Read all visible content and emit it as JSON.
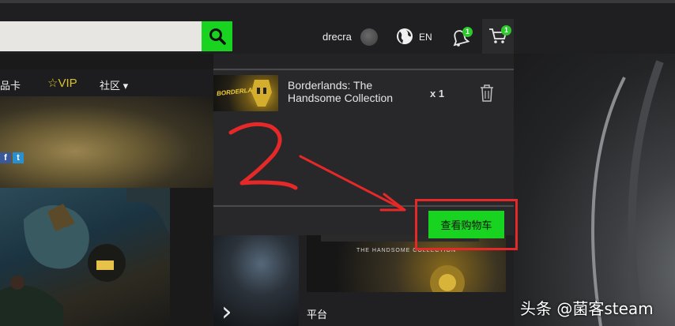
{
  "header": {
    "search": {
      "placeholder": "",
      "value": ""
    },
    "username": "drecra",
    "language": "EN",
    "notifications_count": "1",
    "cart_count": "1"
  },
  "nav": {
    "cards_label": "品卡",
    "vip_label": "VIP",
    "community_label": "社区 ▾"
  },
  "social": {
    "facebook": "f",
    "twitter": "t"
  },
  "cart": {
    "item_logo": "BORDERLANDS",
    "item_title": "Borderlands: The Handsome Collection",
    "item_quantity": "x 1",
    "view_cart_label": "查看购物车"
  },
  "game_card": {
    "cover_text": "THE HANDSOME COLLECTION",
    "platform_label": "平台"
  },
  "annotation": {
    "step_number": "2",
    "accent_color": "#e52828"
  },
  "watermark": "头条 @菌客steam",
  "colors": {
    "brand_green": "#18d320",
    "badge_green": "#2dc92d",
    "vip_gold": "#d9c22b",
    "panel_bg": "#28282a"
  }
}
